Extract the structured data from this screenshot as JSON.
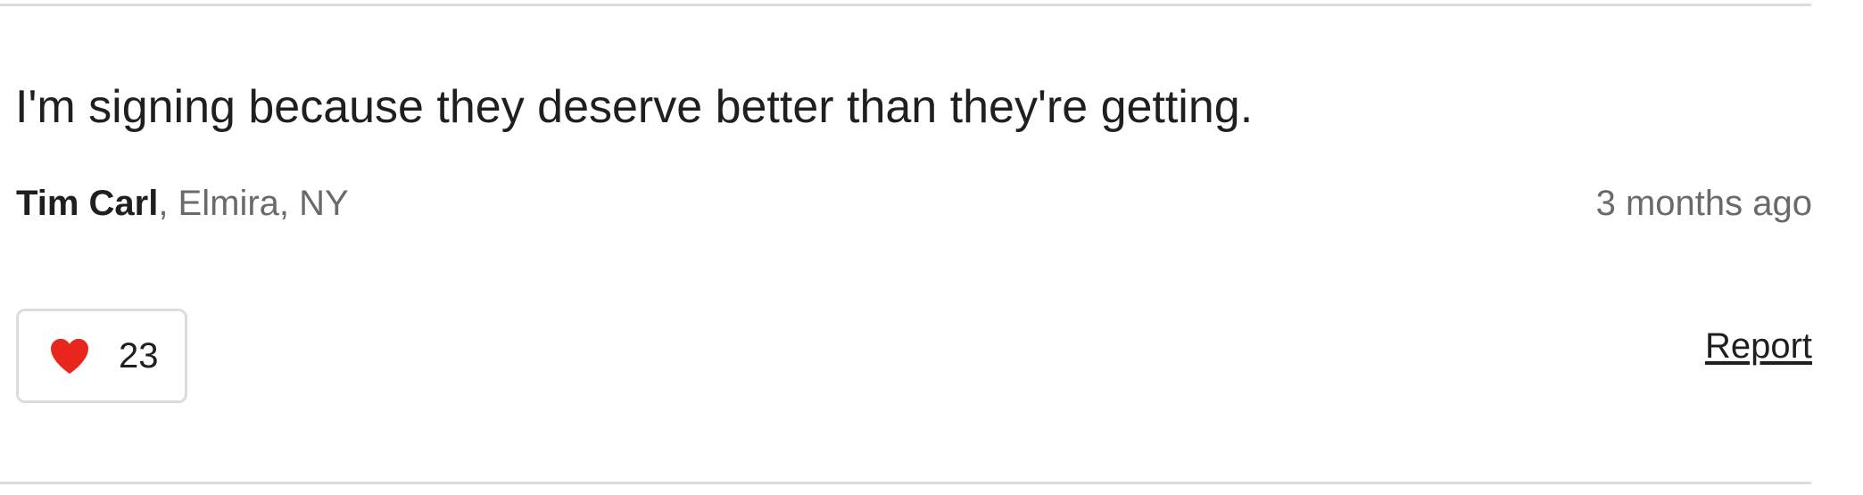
{
  "comment": {
    "text": "I'm signing because they deserve better than they're getting.",
    "author_name": "Tim Carl",
    "author_location": ", Elmira, NY",
    "timestamp": "3 months ago"
  },
  "actions": {
    "like_count": "23",
    "report_label": "Report"
  },
  "icons": {
    "like": "heart-icon"
  },
  "colors": {
    "heart": "#e8261c",
    "divider": "#dcdcdc",
    "muted_text": "#6a6a6a"
  }
}
